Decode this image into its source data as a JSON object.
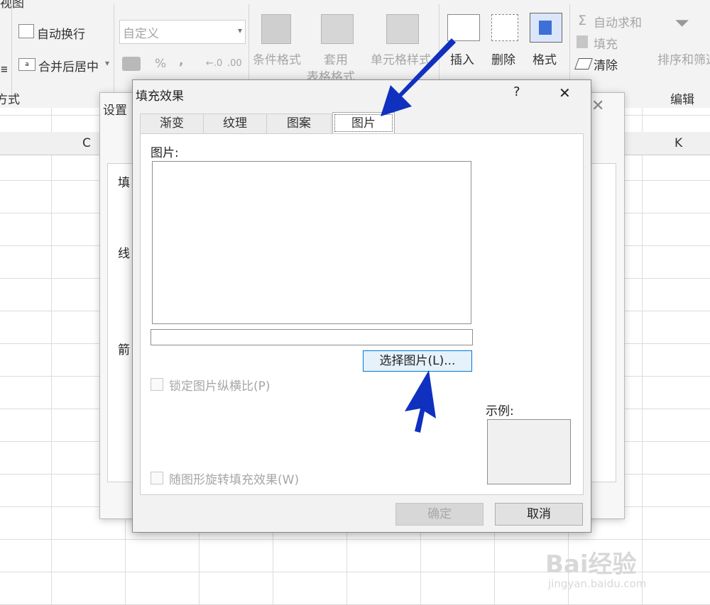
{
  "ribbon": {
    "top_left_partial": "视图",
    "wrap_text": "自动换行",
    "merge_center": "合并后居中",
    "alignment_group_partial": "方式",
    "number_format": "自定义",
    "percent": "%",
    "comma": ",",
    "cond_format": "条件格式",
    "table_format_1": "套用",
    "table_format_2": "表格格式",
    "cell_style": "单元格样式",
    "insert": "插入",
    "delete": "删除",
    "format": "格式",
    "autosum": "自动求和",
    "fill": "填充",
    "clear": "清除",
    "sort_filter": "排序和筛选",
    "editing_group": "编辑"
  },
  "sheet": {
    "col_c": "C",
    "col_k": "K"
  },
  "bg_dialog": {
    "title_partial": "设置",
    "labels": [
      "填",
      "线",
      "箭"
    ]
  },
  "dialog": {
    "title": "填充效果",
    "help": "?",
    "close": "✕",
    "tabs": [
      "渐变",
      "纹理",
      "图案",
      "图片"
    ],
    "picture_label": "图片:",
    "select_picture_btn": "选择图片(L)...",
    "lock_aspect": "锁定图片纵横比(P)",
    "rotate_with_shape": "随图形旋转填充效果(W)",
    "sample_label": "示例:",
    "ok": "确定",
    "cancel": "取消"
  },
  "watermark": {
    "brand": "Bai经验",
    "url": "jingyan.baidu.com"
  }
}
